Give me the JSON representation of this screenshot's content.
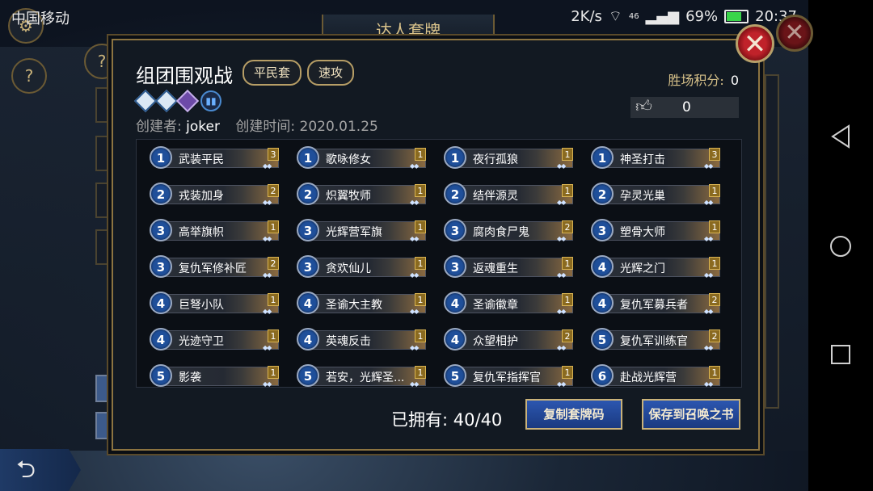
{
  "status_bar": {
    "carrier": "中国移动",
    "speed": "2K/s",
    "network": "46",
    "battery": "69%",
    "time": "20:37"
  },
  "screen_title": "达人套牌",
  "deck": {
    "name": "组团围观战",
    "tags": [
      "平民套",
      "速攻"
    ],
    "creator_label": "创建者:",
    "creator": "joker",
    "created_label": "创建时间:",
    "created_date": "2020.01.25",
    "win_score_label": "胜场积分:",
    "win_score": "0",
    "likes": "0"
  },
  "cards": [
    {
      "cost": "1",
      "name": "武装平民",
      "qty": "3"
    },
    {
      "cost": "1",
      "name": "歌咏修女",
      "qty": "1"
    },
    {
      "cost": "1",
      "name": "夜行孤狼",
      "qty": "1"
    },
    {
      "cost": "1",
      "name": "神圣打击",
      "qty": "3"
    },
    {
      "cost": "2",
      "name": "戎装加身",
      "qty": "2"
    },
    {
      "cost": "2",
      "name": "炽翼牧师",
      "qty": "1"
    },
    {
      "cost": "2",
      "name": "结伴源灵",
      "qty": "1"
    },
    {
      "cost": "2",
      "name": "孕灵光巢",
      "qty": "1"
    },
    {
      "cost": "3",
      "name": "高举旗帜",
      "qty": "1"
    },
    {
      "cost": "3",
      "name": "光辉营军旗",
      "qty": "1"
    },
    {
      "cost": "3",
      "name": "腐肉食尸鬼",
      "qty": "2"
    },
    {
      "cost": "3",
      "name": "塑骨大师",
      "qty": "1"
    },
    {
      "cost": "3",
      "name": "复仇军修补匠",
      "qty": "2"
    },
    {
      "cost": "3",
      "name": "贪欢仙儿",
      "qty": "1"
    },
    {
      "cost": "3",
      "name": "返魂重生",
      "qty": "1"
    },
    {
      "cost": "4",
      "name": "光辉之门",
      "qty": "1"
    },
    {
      "cost": "4",
      "name": "巨弩小队",
      "qty": "1"
    },
    {
      "cost": "4",
      "name": "圣谕大主教",
      "qty": "1"
    },
    {
      "cost": "4",
      "name": "圣谕徽章",
      "qty": "1"
    },
    {
      "cost": "4",
      "name": "复仇军募兵者",
      "qty": "2"
    },
    {
      "cost": "4",
      "name": "光迹守卫",
      "qty": "1"
    },
    {
      "cost": "4",
      "name": "英魂反击",
      "qty": "1"
    },
    {
      "cost": "4",
      "name": "众望相护",
      "qty": "2"
    },
    {
      "cost": "5",
      "name": "复仇军训练官",
      "qty": "2"
    },
    {
      "cost": "5",
      "name": "影袭",
      "qty": "1"
    },
    {
      "cost": "5",
      "name": "若安，光辉圣...",
      "qty": "1"
    },
    {
      "cost": "5",
      "name": "复仇军指挥官",
      "qty": "1"
    },
    {
      "cost": "6",
      "name": "赴战光辉营",
      "qty": "1"
    }
  ],
  "owned_label": "已拥有:",
  "owned_value": "40/40",
  "buttons": {
    "copy_code": "复制套牌码",
    "save": "保存到召唤之书"
  },
  "icons": {
    "close": "close-icon",
    "back": "back-arrow-icon",
    "thumb": "thumbs-up-icon",
    "stats": "stats-icon",
    "settings": "gear-icon",
    "help": "question-icon",
    "trophy": "trophy-icon"
  },
  "colors": {
    "accent_gold": "#c9b27a",
    "button_blue": "#2c56b0",
    "close_red": "#c0222a",
    "cost_blue": "#1f4f9a"
  }
}
